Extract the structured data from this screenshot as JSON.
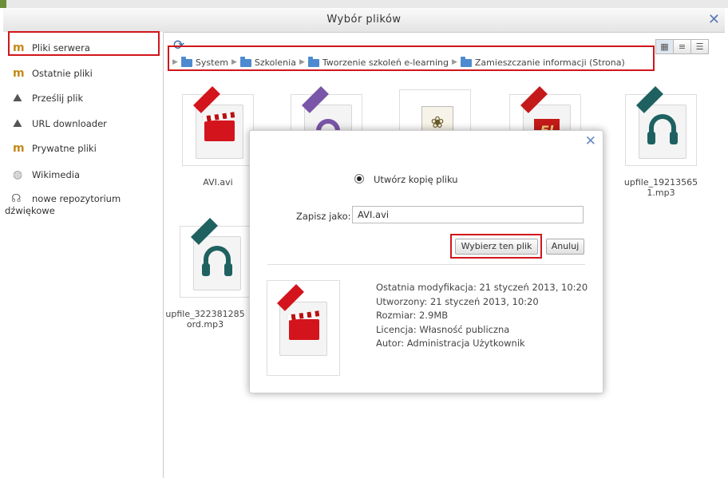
{
  "dialog": {
    "title": "Wybór plików"
  },
  "sidebar": {
    "items": [
      {
        "label": "Pliki serwera",
        "icon": "repository-icon"
      },
      {
        "label": "Ostatnie pliki",
        "icon": "repository-icon"
      },
      {
        "label": "Prześlij plik",
        "icon": "upload-icon"
      },
      {
        "label": "URL downloader",
        "icon": "upload-icon"
      },
      {
        "label": "Prywatne pliki",
        "icon": "repository-icon"
      },
      {
        "label": "Wikimedia",
        "icon": "wikimedia-icon"
      },
      {
        "label_line1": "nowe repozytorium",
        "label_line2": "dźwiękowe",
        "icon": "sound-repository-icon"
      }
    ]
  },
  "toolbar": {
    "refresh_icon": "refresh-icon",
    "views": [
      "icons-view-icon",
      "list-view-icon",
      "tree-view-icon"
    ]
  },
  "breadcrumb": [
    "System",
    "Szkolenia",
    "Tworzenie szkoleń e-learning",
    "Zamieszczanie informacji (Strona)"
  ],
  "files": [
    {
      "name": "AVI.avi",
      "type": "video"
    },
    {
      "name": "",
      "type": "film"
    },
    {
      "name": "",
      "type": "image"
    },
    {
      "name": "",
      "type": "flash"
    },
    {
      "name": "upfile_192135651.mp3",
      "type": "audio"
    },
    {
      "name": "upfile_322381285 ord.mp3",
      "type": "audio"
    }
  ],
  "popup": {
    "radio_label": "Utwórz kopię pliku",
    "save_as_label": "Zapisz jako:",
    "save_as_value": "AVI.avi",
    "select_button": "Wybierz ten plik",
    "cancel_button": "Anuluj",
    "info": {
      "modified": "Ostatnia modyfikacja: 21 styczeń 2013, 10:20",
      "created": "Utworzony: 21 styczeń 2013, 10:20",
      "size": "Rozmiar: 2.9MB",
      "license": "Licencja: Własność publiczna",
      "author": "Autor: Administracja Użytkownik"
    }
  },
  "colors": {
    "highlight": "#d0161b",
    "folder": "#4d8ad0",
    "video": "#d4141d",
    "audio": "#1f6161"
  }
}
